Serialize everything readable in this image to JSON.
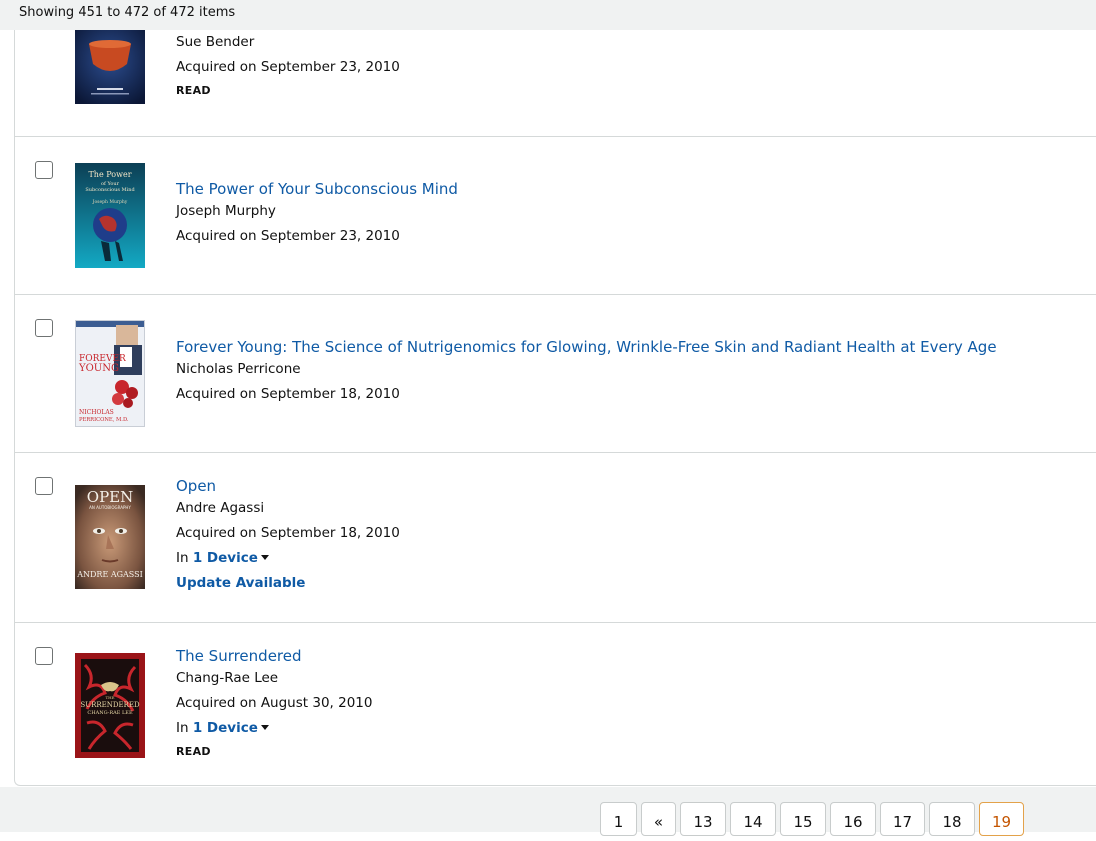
{
  "status_text": "Showing 451 to 472 of 472 items",
  "items": [
    {
      "author": "Sue Bender",
      "acquired": "Acquired on September 23, 2010",
      "read_badge": "READ",
      "cover_colors": [
        "#12254f",
        "#c84a21"
      ]
    },
    {
      "title": "The Power of Your Subconscious Mind",
      "author": "Joseph Murphy",
      "acquired": "Acquired on September 23, 2010",
      "cover_text": [
        "The Power",
        "of Your",
        "Subconscious Mind",
        "Joseph Murphy"
      ],
      "cover_colors": [
        "#0f5f7a",
        "#1f3d8a"
      ]
    },
    {
      "title": "Forever Young: The Science of Nutrigenomics for Glowing, Wrinkle-Free Skin and Radiant Health at Every Age",
      "author": "Nicholas Perricone",
      "acquired": "Acquired on September 18, 2010",
      "cover_text": [
        "FOREVER",
        "YOUNG",
        "NICHOLAS",
        "PERRICONE, M.D."
      ],
      "cover_colors": [
        "#e9edf3",
        "#c8262c"
      ]
    },
    {
      "title": "Open",
      "author": "Andre Agassi",
      "acquired": "Acquired on September 18, 2010",
      "device_prefix": "In",
      "device_link": "1 Device",
      "update_label": "Update Available",
      "cover_text": [
        "OPEN",
        "AN AUTOBIOGRAPHY",
        "ANDRE AGASSI"
      ],
      "cover_colors": [
        "#6b4a36",
        "#e8e2da"
      ]
    },
    {
      "title": "The Surrendered",
      "author": "Chang-Rae Lee",
      "acquired": "Acquired on August 30, 2010",
      "device_prefix": "In",
      "device_link": "1 Device",
      "read_badge": "READ",
      "cover_text": [
        "THE",
        "SURRENDERED",
        "CHANG-RAE LEE"
      ],
      "cover_colors": [
        "#9a1418",
        "#0d0d0d"
      ]
    }
  ],
  "pagination": {
    "pages": [
      "1",
      "«",
      "13",
      "14",
      "15",
      "16",
      "17",
      "18",
      "19"
    ],
    "current": "19"
  }
}
